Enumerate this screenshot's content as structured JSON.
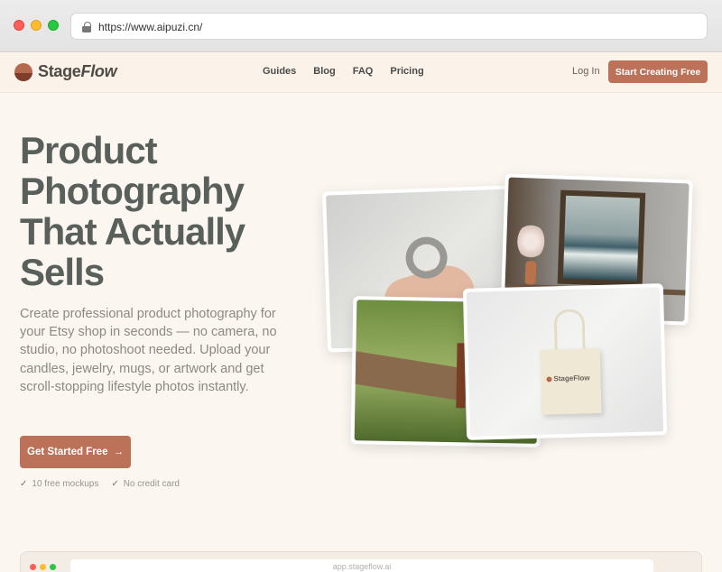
{
  "browser": {
    "url": "https://www.aipuzi.cn/"
  },
  "nav": {
    "brand_a": "Stage",
    "brand_b": "Flow",
    "links": [
      "Guides",
      "Blog",
      "FAQ",
      "Pricing"
    ],
    "login": "Log In",
    "cta": "Start Creating Free"
  },
  "hero": {
    "title_lines": [
      "Product",
      "Photography",
      "That Actually",
      "Sells"
    ],
    "description": "Create professional product photography for your Etsy shop in seconds — no camera, no studio, no photoshoot needed. Upload your candles, jewelry, mugs, or artwork and get scroll-stopping lifestyle photos instantly.",
    "cta": "Get Started Free",
    "cta_arrow": "→",
    "checks": [
      "10 free mockups",
      "No credit card"
    ],
    "check_mark": "✓"
  },
  "collage": {
    "tote_logo": "StageFlow"
  },
  "preview": {
    "url": "app.stageflow.ai"
  },
  "colors": {
    "accent": "#bb7258",
    "title": "#59605c",
    "background": "#fbf6f0"
  }
}
